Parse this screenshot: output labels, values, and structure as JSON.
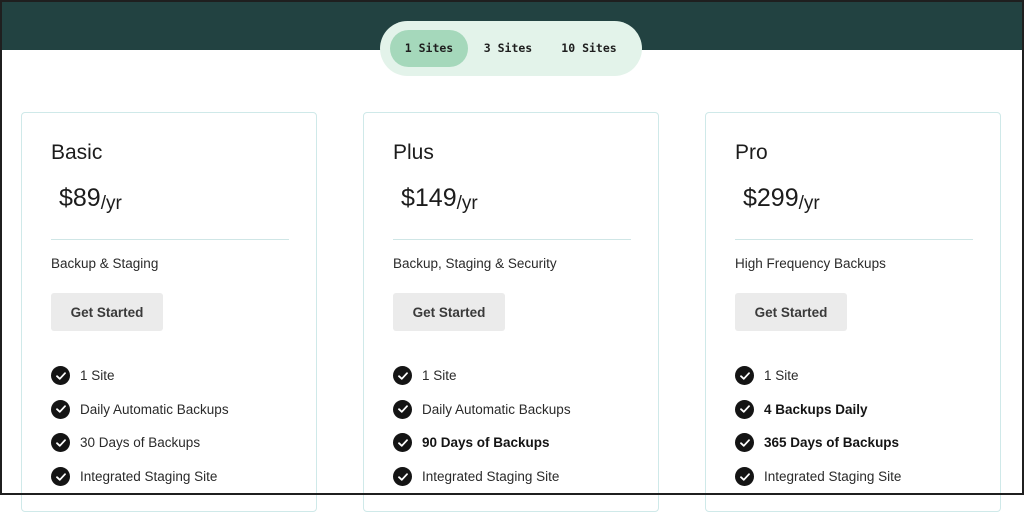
{
  "site_toggle": {
    "options": [
      {
        "label": "1 Sites",
        "active": true
      },
      {
        "label": "3 Sites",
        "active": false
      },
      {
        "label": "10 Sites",
        "active": false
      }
    ]
  },
  "plans": [
    {
      "name": "Basic",
      "price": "$89",
      "unit": "/yr",
      "tagline": "Backup & Staging",
      "cta_label": "Get Started",
      "features": [
        {
          "text": "1 Site",
          "bold": false
        },
        {
          "text": "Daily Automatic Backups",
          "bold": false
        },
        {
          "text": "30 Days of Backups",
          "bold": false
        },
        {
          "text": "Integrated Staging Site",
          "bold": false
        }
      ]
    },
    {
      "name": "Plus",
      "price": "$149",
      "unit": "/yr",
      "tagline": "Backup, Staging & Security",
      "cta_label": "Get Started",
      "features": [
        {
          "text": "1 Site",
          "bold": false
        },
        {
          "text": "Daily Automatic Backups",
          "bold": false
        },
        {
          "text": "90 Days of Backups",
          "bold": true
        },
        {
          "text": "Integrated Staging Site",
          "bold": false
        }
      ]
    },
    {
      "name": "Pro",
      "price": "$299",
      "unit": "/yr",
      "tagline": "High Frequency Backups",
      "cta_label": "Get Started",
      "features": [
        {
          "text": "1 Site",
          "bold": false
        },
        {
          "text": "4 Backups Daily",
          "bold": true
        },
        {
          "text": "365 Days of Backups",
          "bold": true
        },
        {
          "text": "Integrated Staging Site",
          "bold": false
        }
      ]
    }
  ],
  "colors": {
    "header_band": "#224241",
    "toggle_bg": "#e3f3ea",
    "toggle_active": "#a5d8bb",
    "card_border": "#cfe9e9",
    "cta_bg": "#ebebeb",
    "check": "#141414"
  },
  "icons": {
    "feature_bullet": "check-circle-icon"
  }
}
